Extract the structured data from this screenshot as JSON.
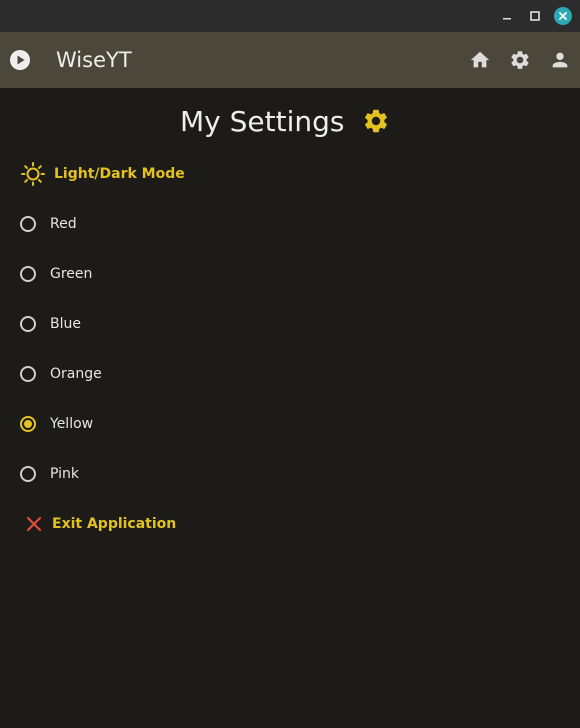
{
  "window": {
    "minimize_icon": "minimize-icon",
    "maximize_icon": "maximize-icon",
    "close_icon": "close-icon",
    "close_color": "#2aa9b5"
  },
  "appbar": {
    "title": "WiseYT",
    "logo_icon": "play-circle-icon",
    "nav": [
      "home-icon",
      "gear-icon",
      "account-icon"
    ],
    "background": "#4b473a"
  },
  "page": {
    "title": "My Settings",
    "title_icon": "gear-icon",
    "accent": "#e3c21f"
  },
  "mode_toggle": {
    "label": "Light/Dark Mode",
    "icon": "sun-icon"
  },
  "theme_options": [
    {
      "label": "Red",
      "selected": false
    },
    {
      "label": "Green",
      "selected": false
    },
    {
      "label": "Blue",
      "selected": false
    },
    {
      "label": "Orange",
      "selected": false
    },
    {
      "label": "Yellow",
      "selected": true
    },
    {
      "label": "Pink",
      "selected": false
    }
  ],
  "exit": {
    "label": "Exit Application",
    "icon": "close-x-icon",
    "icon_color": "#e04b3a"
  }
}
